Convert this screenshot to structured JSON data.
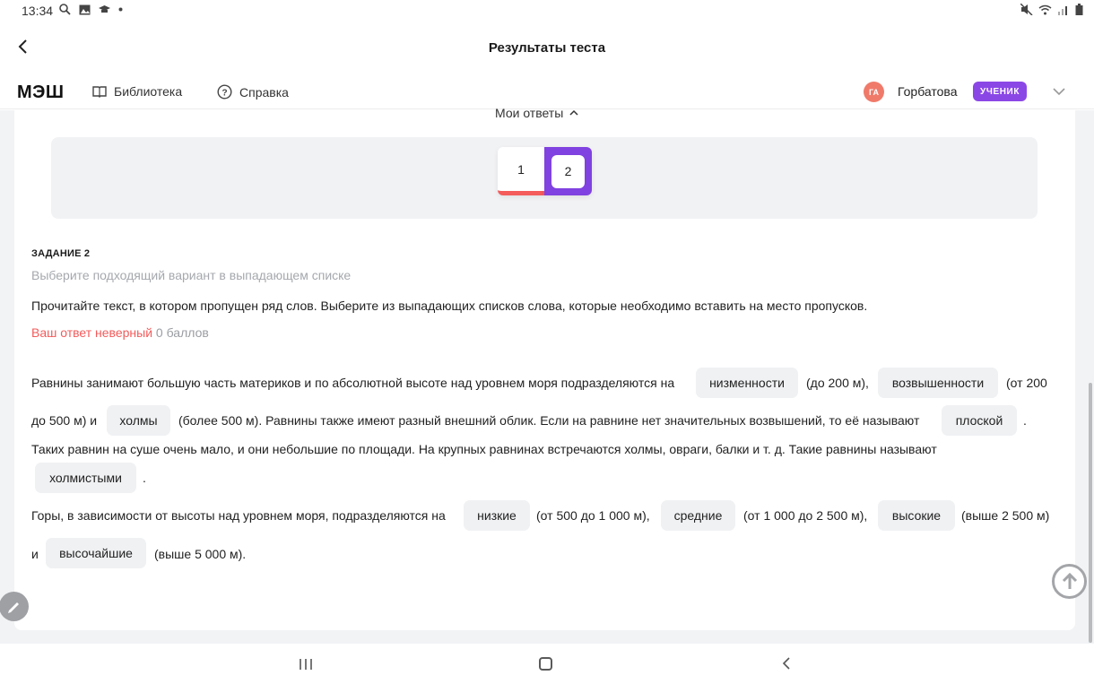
{
  "status": {
    "time": "13:34",
    "left_icons": [
      "search-icon",
      "gallery-icon",
      "graduation-cap-icon",
      "dot-icon"
    ],
    "right_icons": [
      "mute-icon",
      "wifi-icon",
      "signal-icon",
      "battery-icon"
    ]
  },
  "appbar": {
    "title": "Результаты теста"
  },
  "header": {
    "logo": "МЭШ",
    "nav": [
      {
        "label": "Библиотека",
        "icon": "book-icon"
      },
      {
        "label": "Справка",
        "icon": "help-circle-icon"
      }
    ],
    "user": {
      "initials": "ГА",
      "name": "Горбатова",
      "role": "УЧЕНИК"
    }
  },
  "answers": {
    "label": "Мои ответы",
    "items": [
      {
        "number": "1",
        "status": "wrong"
      },
      {
        "number": "2",
        "status": "selected"
      }
    ]
  },
  "task": {
    "label": "ЗАДАНИЕ 2",
    "hint": "Выберите подходящий вариант в выпадающем списке",
    "text": "Прочитайте текст, в котором пропущен ряд слов. Выберите из выпадающих списков слова, которые необходимо вставить на место пропусков.",
    "result_wrong": "Ваш ответ неверный",
    "result_score": "0 баллов"
  },
  "paragraph1": {
    "t1": "Равнины занимают большую часть материков и по абсолютной высоте над уровнем моря подразделяются на",
    "c1": "низменности",
    "t2": "(до 200 м),",
    "c2": "возвышенности",
    "t3": "(от 200",
    "t4": "до 500 м) и",
    "c3": "холмы",
    "t5": "(более 500 м). Равнины также имеют разный внешний облик. Если на равнине нет значительных возвышений, то её называют",
    "c4": "плоской",
    "t6": ".",
    "t7": "Таких равнин на суше очень мало, и они небольшие по площади. На крупных равнинах встречаются холмы, овраги, балки и т. д. Такие равнины называют",
    "c5": "холмистыми",
    "t8": "."
  },
  "paragraph2": {
    "t1": "Горы, в зависимости от высоты над уровнем моря, подразделяются на",
    "c1": "низкие",
    "t2": "(от 500 до 1 000 м),",
    "c2": "средние",
    "t3": "(от 1 000 до 2 500 м),",
    "c3": "высокие",
    "t4": "(выше 2 500 м)",
    "t5": "и",
    "c4": "высочайшие",
    "t6": "(выше 5 000 м)."
  },
  "colors": {
    "accent": "#8042e0",
    "wrong": "#f25b5b",
    "avatar": "#f07a6a",
    "chip_bg": "#f0f1f3"
  }
}
